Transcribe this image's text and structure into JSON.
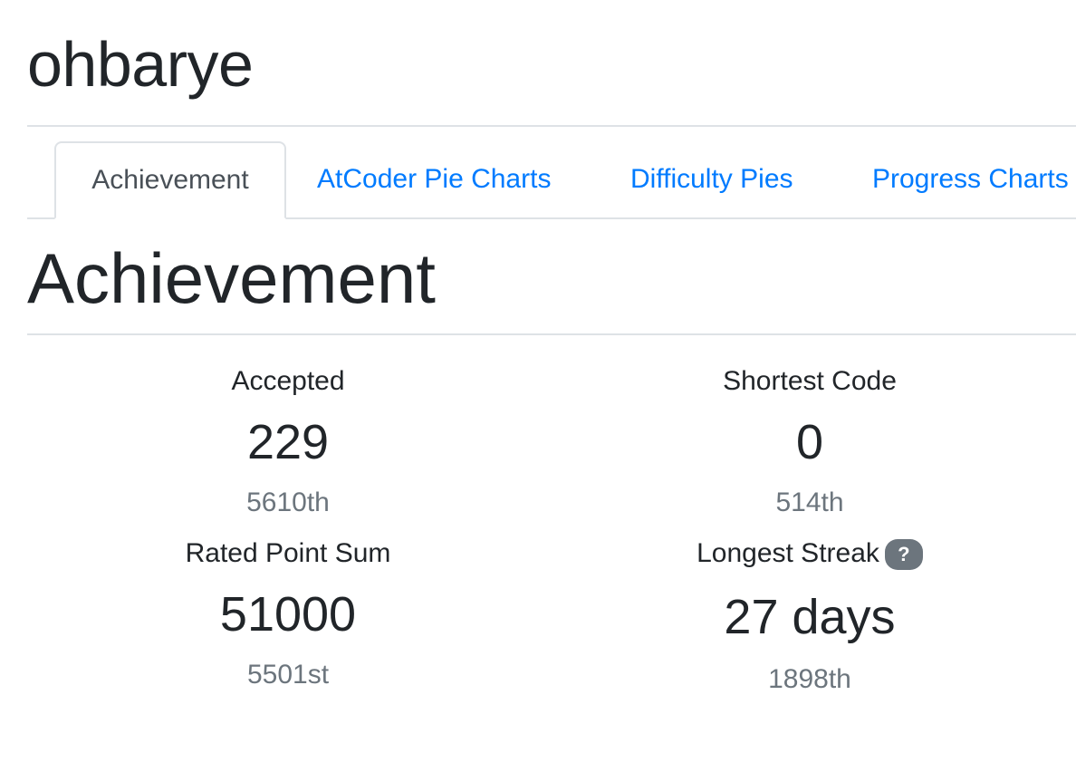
{
  "user": {
    "name": "ohbarye"
  },
  "tabs": [
    {
      "label": "Achievement",
      "active": true
    },
    {
      "label": "AtCoder Pie Charts",
      "active": false
    },
    {
      "label": "Difficulty Pies",
      "active": false
    },
    {
      "label": "Progress Charts",
      "active": false
    }
  ],
  "section": {
    "title": "Achievement"
  },
  "stats": {
    "accepted": {
      "label": "Accepted",
      "value": "229",
      "rank": "5610th"
    },
    "shortest_code": {
      "label": "Shortest Code",
      "value": "0",
      "rank": "514th"
    },
    "rated_point_sum": {
      "label": "Rated Point Sum",
      "value": "51000",
      "rank": "5501st"
    },
    "longest_streak": {
      "label": "Longest Streak",
      "value": "27 days",
      "rank": "1898th",
      "help": "?"
    }
  },
  "colors": {
    "link": "#007bff",
    "text": "#212529",
    "muted": "#6c757d",
    "border": "#dee2e6",
    "badge": "#6c757d"
  },
  "icons": {
    "help": "question-mark-icon"
  }
}
